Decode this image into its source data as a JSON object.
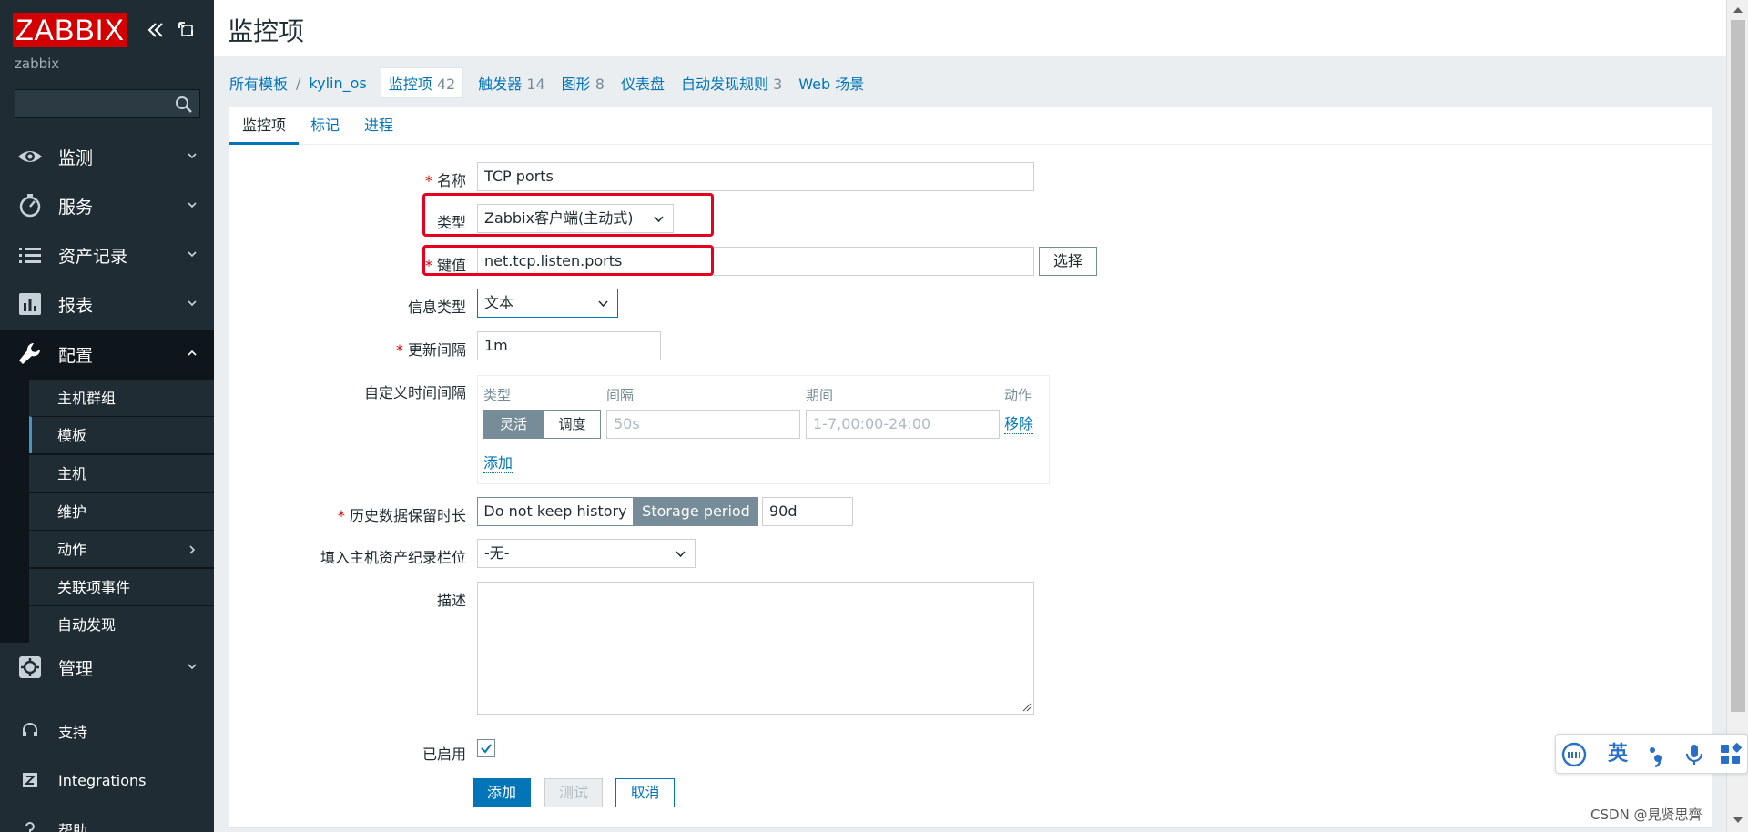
{
  "app": {
    "logo": "ZABBIX",
    "server_name": "zabbix",
    "search_placeholder": ""
  },
  "sidebar": {
    "sections": [
      {
        "label": "监测",
        "icon": "eye-icon"
      },
      {
        "label": "服务",
        "icon": "clock-icon"
      },
      {
        "label": "资产记录",
        "icon": "list-icon"
      },
      {
        "label": "报表",
        "icon": "bar-chart-icon"
      },
      {
        "label": "配置",
        "icon": "wrench-icon",
        "open": true
      },
      {
        "label": "管理",
        "icon": "gear-icon"
      }
    ],
    "config_items": [
      {
        "label": "主机群组"
      },
      {
        "label": "模板",
        "selected": true
      },
      {
        "label": "主机"
      },
      {
        "label": "维护"
      },
      {
        "label": "动作",
        "has_children": true
      },
      {
        "label": "关联项事件"
      },
      {
        "label": "自动发现"
      }
    ],
    "bottom": [
      {
        "label": "支持",
        "icon": "headset-icon"
      },
      {
        "label": "Integrations",
        "icon": "zabbix-z-icon"
      },
      {
        "label": "帮助",
        "icon": "help-icon"
      }
    ]
  },
  "header": {
    "title": "监控项"
  },
  "breadcrumb": {
    "all_templates": "所有模板",
    "separator": "/",
    "template": "kylin_os",
    "items": {
      "label": "监控项",
      "count": "42"
    },
    "triggers": {
      "label": "触发器",
      "count": "14"
    },
    "graphs": {
      "label": "图形",
      "count": "8"
    },
    "dashboards": {
      "label": "仪表盘"
    },
    "discovery": {
      "label": "自动发现规则",
      "count": "3"
    },
    "web": {
      "label": "Web 场景"
    }
  },
  "tabs": [
    {
      "label": "监控项",
      "active": true
    },
    {
      "label": "标记"
    },
    {
      "label": "进程"
    }
  ],
  "form": {
    "required_mark": "*",
    "name": {
      "label": "名称",
      "value": "TCP ports"
    },
    "type": {
      "label": "类型",
      "value": "Zabbix客户端(主动式)"
    },
    "key": {
      "label": "键值",
      "value": "net.tcp.listen.ports",
      "button": "选择"
    },
    "info_type": {
      "label": "信息类型",
      "value": "文本"
    },
    "update_interval": {
      "label": "更新间隔",
      "value": "1m"
    },
    "custom_intervals": {
      "label": "自定义时间间隔",
      "headers": {
        "type": "类型",
        "interval": "间隔",
        "period": "期间",
        "action": "动作"
      },
      "row": {
        "flexible": "灵活",
        "scheduling": "调度",
        "interval_placeholder": "50s",
        "period_placeholder": "1-7,00:00-24:00",
        "remove": "移除"
      },
      "add": "添加"
    },
    "history": {
      "label": "历史数据保留时长",
      "option_no": "Do not keep history",
      "option_storage": "Storage period",
      "value": "90d"
    },
    "inventory": {
      "label": "填入主机资产纪录栏位",
      "value": "-无-"
    },
    "description": {
      "label": "描述",
      "value": ""
    },
    "enabled": {
      "label": "已启用",
      "checked": true
    }
  },
  "actions": {
    "add": "添加",
    "test": "测试",
    "cancel": "取消"
  },
  "ime": {
    "lang": "英"
  },
  "watermark": "CSDN @見贤思齊",
  "colors": {
    "sidebar_bg": "#1f2c33",
    "logo_red": "#d40000",
    "link_blue": "#0275b8",
    "annotation_red": "#e6001e"
  }
}
